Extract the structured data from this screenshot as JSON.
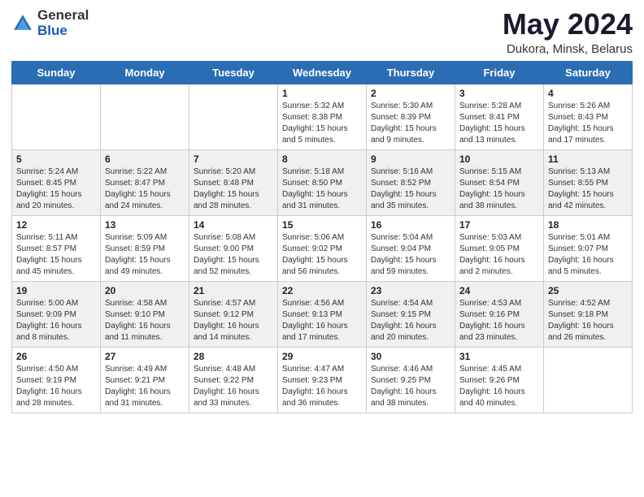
{
  "logo": {
    "general": "General",
    "blue": "Blue"
  },
  "header": {
    "month": "May 2024",
    "location": "Dukora, Minsk, Belarus"
  },
  "weekdays": [
    "Sunday",
    "Monday",
    "Tuesday",
    "Wednesday",
    "Thursday",
    "Friday",
    "Saturday"
  ],
  "weeks": [
    [
      {
        "day": "",
        "info": ""
      },
      {
        "day": "",
        "info": ""
      },
      {
        "day": "",
        "info": ""
      },
      {
        "day": "1",
        "info": "Sunrise: 5:32 AM\nSunset: 8:38 PM\nDaylight: 15 hours\nand 5 minutes."
      },
      {
        "day": "2",
        "info": "Sunrise: 5:30 AM\nSunset: 8:39 PM\nDaylight: 15 hours\nand 9 minutes."
      },
      {
        "day": "3",
        "info": "Sunrise: 5:28 AM\nSunset: 8:41 PM\nDaylight: 15 hours\nand 13 minutes."
      },
      {
        "day": "4",
        "info": "Sunrise: 5:26 AM\nSunset: 8:43 PM\nDaylight: 15 hours\nand 17 minutes."
      }
    ],
    [
      {
        "day": "5",
        "info": "Sunrise: 5:24 AM\nSunset: 8:45 PM\nDaylight: 15 hours\nand 20 minutes."
      },
      {
        "day": "6",
        "info": "Sunrise: 5:22 AM\nSunset: 8:47 PM\nDaylight: 15 hours\nand 24 minutes."
      },
      {
        "day": "7",
        "info": "Sunrise: 5:20 AM\nSunset: 8:48 PM\nDaylight: 15 hours\nand 28 minutes."
      },
      {
        "day": "8",
        "info": "Sunrise: 5:18 AM\nSunset: 8:50 PM\nDaylight: 15 hours\nand 31 minutes."
      },
      {
        "day": "9",
        "info": "Sunrise: 5:16 AM\nSunset: 8:52 PM\nDaylight: 15 hours\nand 35 minutes."
      },
      {
        "day": "10",
        "info": "Sunrise: 5:15 AM\nSunset: 8:54 PM\nDaylight: 15 hours\nand 38 minutes."
      },
      {
        "day": "11",
        "info": "Sunrise: 5:13 AM\nSunset: 8:55 PM\nDaylight: 15 hours\nand 42 minutes."
      }
    ],
    [
      {
        "day": "12",
        "info": "Sunrise: 5:11 AM\nSunset: 8:57 PM\nDaylight: 15 hours\nand 45 minutes."
      },
      {
        "day": "13",
        "info": "Sunrise: 5:09 AM\nSunset: 8:59 PM\nDaylight: 15 hours\nand 49 minutes."
      },
      {
        "day": "14",
        "info": "Sunrise: 5:08 AM\nSunset: 9:00 PM\nDaylight: 15 hours\nand 52 minutes."
      },
      {
        "day": "15",
        "info": "Sunrise: 5:06 AM\nSunset: 9:02 PM\nDaylight: 15 hours\nand 56 minutes."
      },
      {
        "day": "16",
        "info": "Sunrise: 5:04 AM\nSunset: 9:04 PM\nDaylight: 15 hours\nand 59 minutes."
      },
      {
        "day": "17",
        "info": "Sunrise: 5:03 AM\nSunset: 9:05 PM\nDaylight: 16 hours\nand 2 minutes."
      },
      {
        "day": "18",
        "info": "Sunrise: 5:01 AM\nSunset: 9:07 PM\nDaylight: 16 hours\nand 5 minutes."
      }
    ],
    [
      {
        "day": "19",
        "info": "Sunrise: 5:00 AM\nSunset: 9:09 PM\nDaylight: 16 hours\nand 8 minutes."
      },
      {
        "day": "20",
        "info": "Sunrise: 4:58 AM\nSunset: 9:10 PM\nDaylight: 16 hours\nand 11 minutes."
      },
      {
        "day": "21",
        "info": "Sunrise: 4:57 AM\nSunset: 9:12 PM\nDaylight: 16 hours\nand 14 minutes."
      },
      {
        "day": "22",
        "info": "Sunrise: 4:56 AM\nSunset: 9:13 PM\nDaylight: 16 hours\nand 17 minutes."
      },
      {
        "day": "23",
        "info": "Sunrise: 4:54 AM\nSunset: 9:15 PM\nDaylight: 16 hours\nand 20 minutes."
      },
      {
        "day": "24",
        "info": "Sunrise: 4:53 AM\nSunset: 9:16 PM\nDaylight: 16 hours\nand 23 minutes."
      },
      {
        "day": "25",
        "info": "Sunrise: 4:52 AM\nSunset: 9:18 PM\nDaylight: 16 hours\nand 26 minutes."
      }
    ],
    [
      {
        "day": "26",
        "info": "Sunrise: 4:50 AM\nSunset: 9:19 PM\nDaylight: 16 hours\nand 28 minutes."
      },
      {
        "day": "27",
        "info": "Sunrise: 4:49 AM\nSunset: 9:21 PM\nDaylight: 16 hours\nand 31 minutes."
      },
      {
        "day": "28",
        "info": "Sunrise: 4:48 AM\nSunset: 9:22 PM\nDaylight: 16 hours\nand 33 minutes."
      },
      {
        "day": "29",
        "info": "Sunrise: 4:47 AM\nSunset: 9:23 PM\nDaylight: 16 hours\nand 36 minutes."
      },
      {
        "day": "30",
        "info": "Sunrise: 4:46 AM\nSunset: 9:25 PM\nDaylight: 16 hours\nand 38 minutes."
      },
      {
        "day": "31",
        "info": "Sunrise: 4:45 AM\nSunset: 9:26 PM\nDaylight: 16 hours\nand 40 minutes."
      },
      {
        "day": "",
        "info": ""
      }
    ]
  ]
}
